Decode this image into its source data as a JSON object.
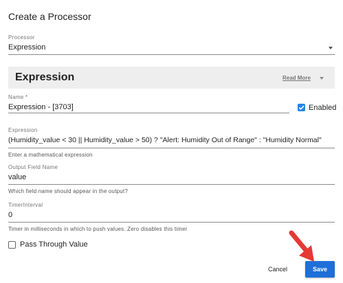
{
  "dialog": {
    "title": "Create a Processor"
  },
  "processor": {
    "label": "Processor",
    "value": "Expression"
  },
  "section": {
    "title": "Expression",
    "read_more": "Read More"
  },
  "name_field": {
    "label": "Name *",
    "value": "Expression  - [3703]"
  },
  "enabled": {
    "label": "Enabled",
    "checked": true
  },
  "expression_field": {
    "label": "Expression",
    "value": "(Humidity_value < 30 || Humidity_value > 50) ? \"Alert: Humidity Out of Range\" : \"Humidity Normal\"",
    "hint": "Enter a mathematical expression"
  },
  "output_field": {
    "label": "Output Field Name",
    "value": "value",
    "hint": "Which field name should appear in the output?"
  },
  "timer_field": {
    "label": "TimerInterval",
    "value": "0",
    "hint": "Timer in milliseconds in which to push values. Zero disables this timer"
  },
  "pass_through": {
    "label": "Pass Through Value",
    "checked": false
  },
  "actions": {
    "cancel": "Cancel",
    "save": "Save"
  },
  "colors": {
    "primary": "#1e6fd9",
    "checkbox": "#1e88e5",
    "annotation_arrow": "#e53935",
    "section_bg": "#eeeeee"
  },
  "icons": {
    "processor_dropdown": "chevron-down-icon",
    "read_more": "chevron-down-icon",
    "annotation": "red-arrow-icon"
  }
}
